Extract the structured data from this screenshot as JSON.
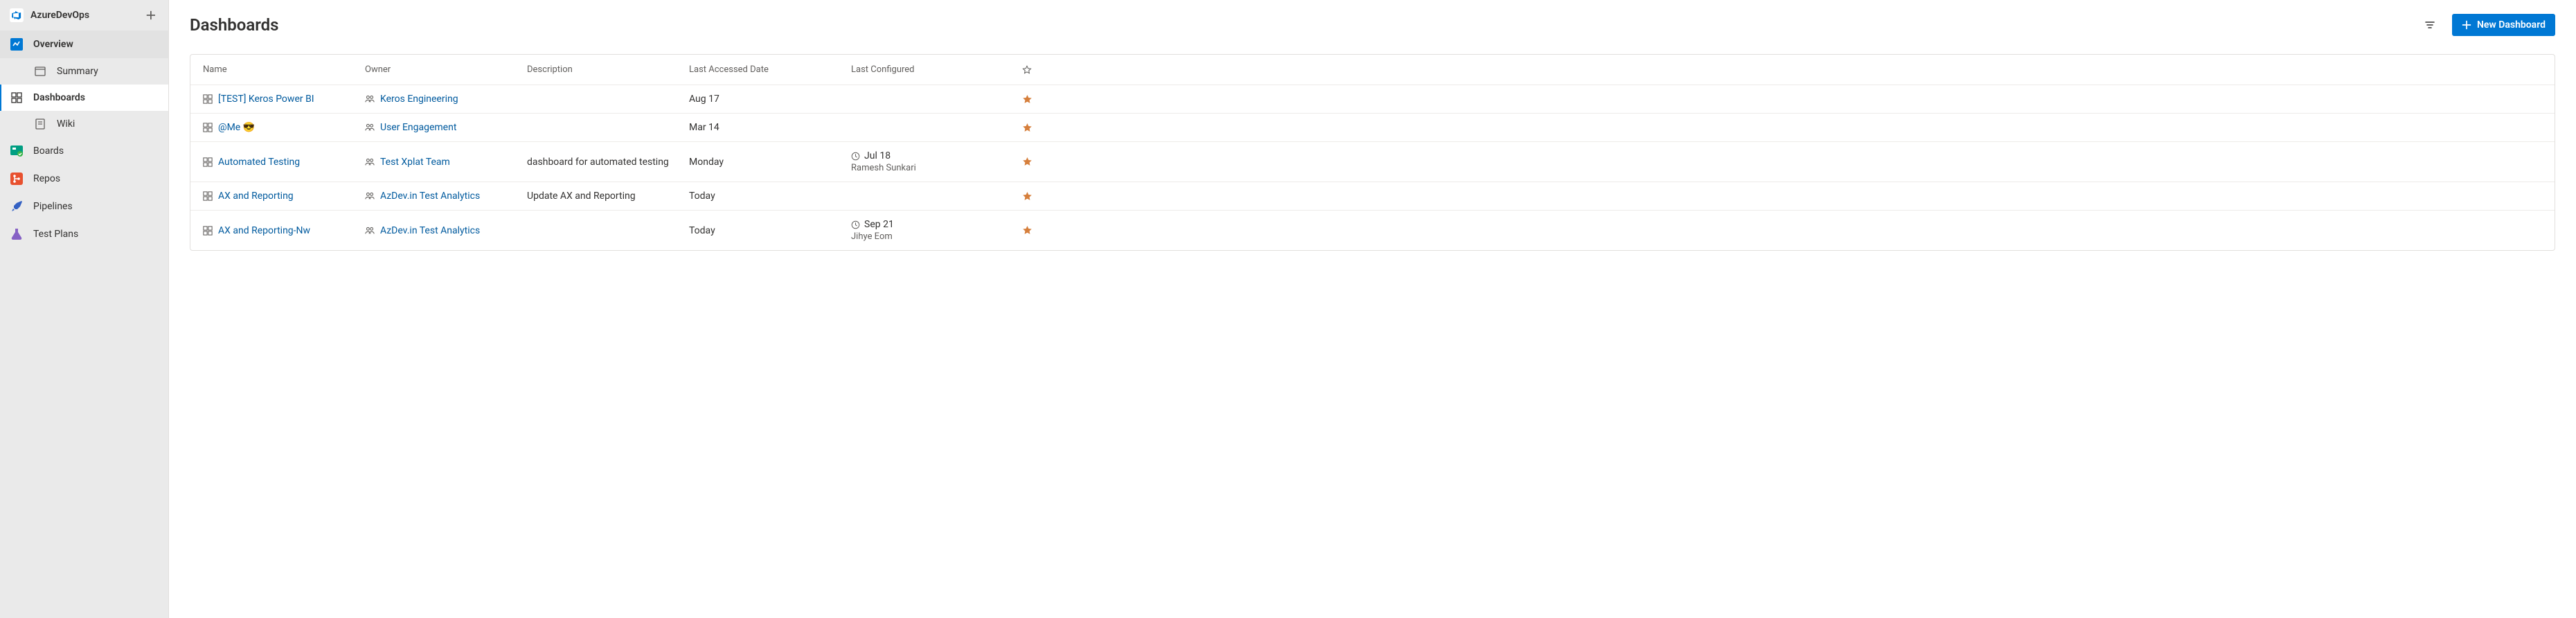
{
  "project": {
    "name": "AzureDevOps"
  },
  "sidebar": {
    "overview": "Overview",
    "summary": "Summary",
    "dashboards": "Dashboards",
    "wiki": "Wiki",
    "boards": "Boards",
    "repos": "Repos",
    "pipelines": "Pipelines",
    "testplans": "Test Plans"
  },
  "page": {
    "title": "Dashboards",
    "new_btn": "New Dashboard"
  },
  "columns": {
    "name": "Name",
    "owner": "Owner",
    "description": "Description",
    "last_accessed": "Last Accessed Date",
    "last_configured": "Last Configured"
  },
  "rows": [
    {
      "name": "[TEST] Keros Power BI",
      "owner": "Keros Engineering",
      "description": "",
      "last_accessed": "Aug 17",
      "configured_date": "",
      "configured_by": ""
    },
    {
      "name": "@Me 😎",
      "owner": "User Engagement",
      "description": "",
      "last_accessed": "Mar 14",
      "configured_date": "",
      "configured_by": ""
    },
    {
      "name": "Automated Testing",
      "owner": "Test Xplat Team",
      "description": "dashboard for automated testing",
      "last_accessed": "Monday",
      "configured_date": "Jul 18",
      "configured_by": "Ramesh Sunkari"
    },
    {
      "name": "AX and Reporting",
      "owner": "AzDev.in Test Analytics",
      "description": "Update AX and Reporting",
      "last_accessed": "Today",
      "configured_date": "",
      "configured_by": ""
    },
    {
      "name": "AX and Reporting-Nw",
      "owner": "AzDev.in Test Analytics",
      "description": "",
      "last_accessed": "Today",
      "configured_date": "Sep 21",
      "configured_by": "Jihye Eom"
    }
  ]
}
